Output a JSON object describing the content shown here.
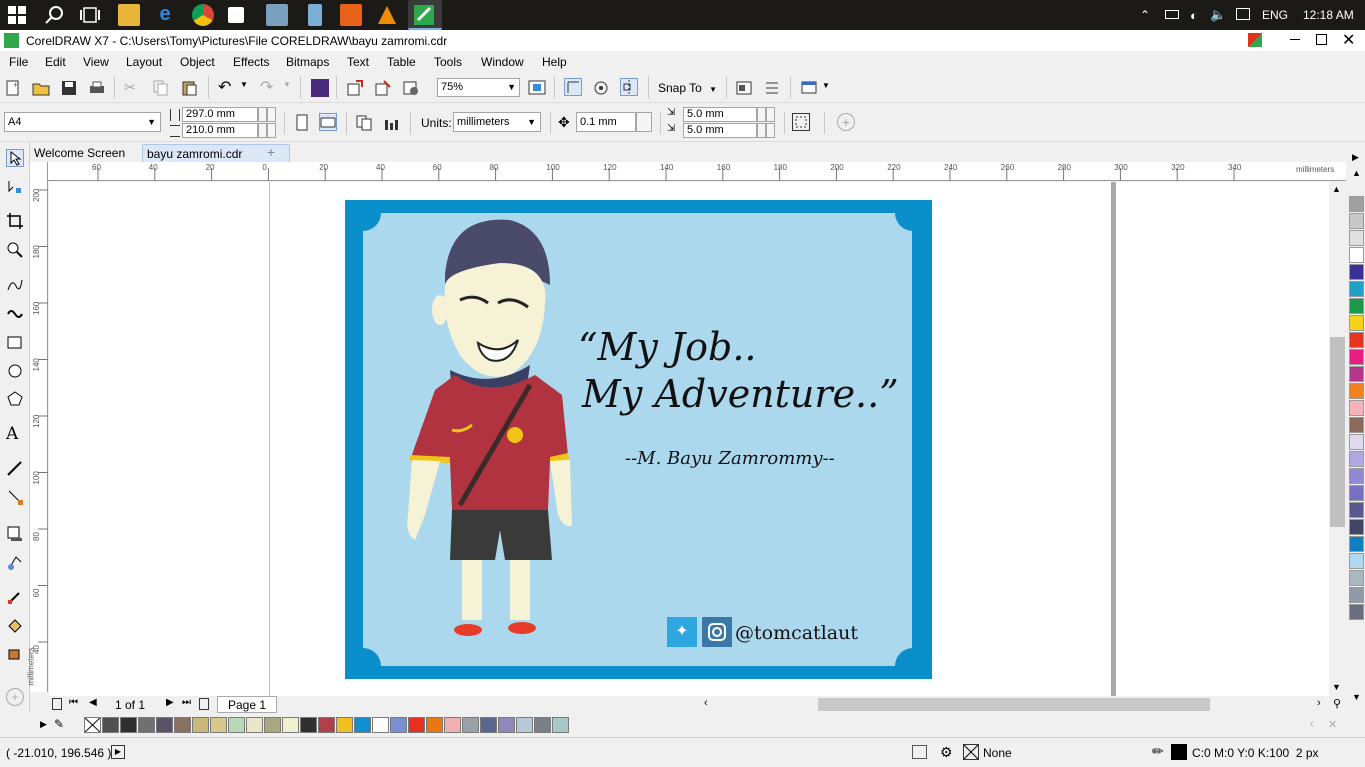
{
  "taskbar": {
    "language": "ENG",
    "time": "12:18 AM"
  },
  "window": {
    "title": "CorelDRAW X7 - C:\\Users\\Tomy\\Pictures\\File CORELDRAW\\bayu zamromi.cdr"
  },
  "menu": [
    "File",
    "Edit",
    "View",
    "Layout",
    "Object",
    "Effects",
    "Bitmaps",
    "Text",
    "Table",
    "Tools",
    "Window",
    "Help"
  ],
  "toolbar": {
    "zoom": "75%",
    "snap_to": "Snap To"
  },
  "properties": {
    "page_size": "A4",
    "width": "297.0 mm",
    "height": "210.0 mm",
    "units_label": "Units:",
    "units": "millimeters",
    "nudge": "0.1 mm",
    "dup_x": "5.0 mm",
    "dup_y": "5.0 mm"
  },
  "tabs": [
    "Welcome Screen",
    "bayu zamromi.cdr"
  ],
  "ruler": {
    "h_ticks": [
      "60",
      "40",
      "20",
      "0",
      "20",
      "40",
      "60",
      "80",
      "100",
      "120",
      "140",
      "160",
      "180",
      "200",
      "220",
      "240",
      "260",
      "280",
      "300",
      "320",
      "340"
    ],
    "h_unit": "millimeters",
    "v_ticks": [
      "200",
      "180",
      "160",
      "140",
      "120",
      "100",
      "80",
      "60",
      "40"
    ],
    "v_unit": "millimeters"
  },
  "artwork": {
    "quote_line1": "“My Job..",
    "quote_line2": "My Adventure..”",
    "author": "--M. Bayu Zamrommy--",
    "handle": "@tomcatlaut"
  },
  "page_nav": {
    "position": "1 of 1",
    "page_tab": "Page 1"
  },
  "status": {
    "coordinates": "( -21.010, 196.546 )",
    "fill": "None",
    "outline": "C:0 M:0 Y:0 K:100  2 px"
  },
  "colors": {
    "frame": "#0a8fcb",
    "background": "#acd8ee",
    "shirt": "#b0333f",
    "cap": "#4a4a6a"
  },
  "palette_right": [
    "#a0a0a0",
    "#c8c8c8",
    "#e0e0e0",
    "#ffffff",
    "#3b3095",
    "#1fa0c8",
    "#1c9a4a",
    "#f4d31a",
    "#e8331e",
    "#e81e82",
    "#b4358c",
    "#f08020",
    "#f5b2b8",
    "#8a6a5a",
    "#e0d8f0",
    "#b0a8e0",
    "#9088d0",
    "#7870c0",
    "#5a5890",
    "#444466",
    "#1080c0",
    "#b0d8f0",
    "#a8b8c0",
    "#909aa8",
    "#687080"
  ],
  "palette_bottom": [
    "#505050",
    "#303030",
    "#707070",
    "#5a5266",
    "#8a7060",
    "#c8b87a",
    "#d8c88a",
    "#b8d8b8",
    "#e8e8c8",
    "#a8a880",
    "#f0f0d0",
    "#303030",
    "#b0404a",
    "#f0c020",
    "#1090d0",
    "#ffffff",
    "#7890d0",
    "#e83020",
    "#e87810",
    "#f0b0b0",
    "#9aa0a8",
    "#5a6890",
    "#9088b8",
    "#b8c8d8",
    "#7a8088",
    "#a8c8c8"
  ]
}
